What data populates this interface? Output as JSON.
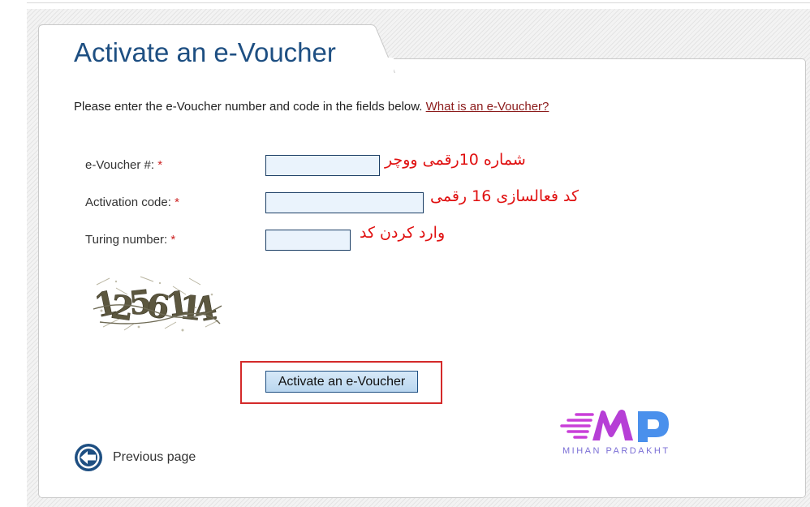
{
  "page": {
    "title": "Activate an e-Voucher",
    "intro_text": "Please enter the e-Voucher number and code in the fields below. ",
    "intro_link": "What is an e-Voucher?"
  },
  "form": {
    "required_marker": "*",
    "fields": [
      {
        "label": "e-Voucher #:",
        "value": "",
        "note": "شماره 10رقمی ووچر"
      },
      {
        "label": "Activation code:",
        "value": "",
        "note": "کد فعالسازی 16 رقمی"
      },
      {
        "label": "Turing number:",
        "value": "",
        "note": "وارد کردن کد"
      }
    ],
    "captcha_text": "1256114",
    "submit_label": "Activate an e-Voucher"
  },
  "navigation": {
    "previous_label": "Previous page",
    "previous_icon": "arrow-left-circle-icon"
  },
  "watermark": {
    "brand": "MIHAN PARDAKHT"
  },
  "colors": {
    "title": "#1e4f82",
    "link": "#8b1a1a",
    "required": "#cc2222",
    "annotation": "#e01010",
    "highlight_border": "#d42a2a",
    "input_background": "#eaf3fc",
    "logo_pink": "#c93fd8",
    "logo_purple": "#7b6fd6",
    "logo_blue": "#4a90ec"
  }
}
